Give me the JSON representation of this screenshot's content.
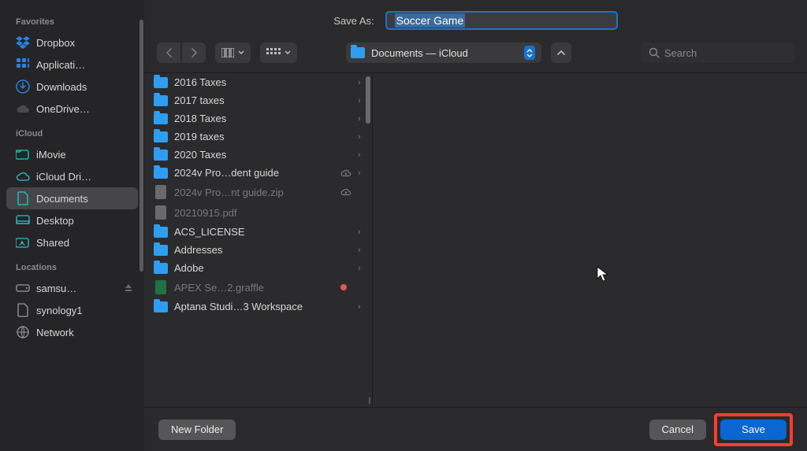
{
  "saveAs": {
    "label": "Save As:",
    "filename": "Soccer Game"
  },
  "location": {
    "label": "Documents — iCloud"
  },
  "search": {
    "placeholder": "Search"
  },
  "sidebar": {
    "sections": [
      {
        "header": "Favorites",
        "items": [
          {
            "icon": "dropbox",
            "label": "Dropbox",
            "color": "#2a81e2"
          },
          {
            "icon": "app-grid",
            "label": "Applicati…",
            "color": "#2a81e2"
          },
          {
            "icon": "download",
            "label": "Downloads",
            "color": "#2a81e2"
          },
          {
            "icon": "cloud-dark",
            "label": "OneDrive…",
            "color": "#6a6a6c"
          }
        ]
      },
      {
        "header": "iCloud",
        "items": [
          {
            "icon": "folder-out",
            "label": "iMovie",
            "color": "#29c3c8"
          },
          {
            "icon": "cloud",
            "label": "iCloud Dri…",
            "color": "#29c3c8"
          },
          {
            "icon": "document",
            "label": "Documents",
            "color": "#29c3c8",
            "selected": true
          },
          {
            "icon": "desktop",
            "label": "Desktop",
            "color": "#29c3c8"
          },
          {
            "icon": "shared",
            "label": "Shared",
            "color": "#29c3c8"
          }
        ]
      },
      {
        "header": "Locations",
        "items": [
          {
            "icon": "drive",
            "label": "samsu…",
            "color": "#9a9a9c",
            "eject": true
          },
          {
            "icon": "document",
            "label": "synology1",
            "color": "#9a9a9c"
          },
          {
            "icon": "network",
            "label": "Network",
            "color": "#9a9a9c"
          }
        ]
      }
    ]
  },
  "files": [
    {
      "icon": "folder",
      "name": "2016 Taxes",
      "chevron": true
    },
    {
      "icon": "folder",
      "name": "2017 taxes",
      "chevron": true
    },
    {
      "icon": "folder",
      "name": "2018 Taxes",
      "chevron": true
    },
    {
      "icon": "folder",
      "name": "2019 taxes",
      "chevron": true
    },
    {
      "icon": "folder",
      "name": "2020 Taxes",
      "chevron": true
    },
    {
      "icon": "folder",
      "name": "2024v Pro…dent guide",
      "chevron": true,
      "cloud": true
    },
    {
      "icon": "doc",
      "name": "2024v Pro…nt guide.zip",
      "dimmed": true,
      "cloud": true
    },
    {
      "icon": "doc",
      "name": "20210915.pdf",
      "dimmed": true
    },
    {
      "icon": "folder",
      "name": "ACS_LICENSE",
      "chevron": true
    },
    {
      "icon": "folder",
      "name": "Addresses",
      "chevron": true
    },
    {
      "icon": "folder",
      "name": "Adobe",
      "chevron": true
    },
    {
      "icon": "excel",
      "name": "APEX Se…2.graffle",
      "dimmed": true,
      "dot": true
    },
    {
      "icon": "folder",
      "name": "Aptana Studi…3 Workspace",
      "chevron": true
    }
  ],
  "footer": {
    "newFolder": "New Folder",
    "cancel": "Cancel",
    "save": "Save"
  }
}
